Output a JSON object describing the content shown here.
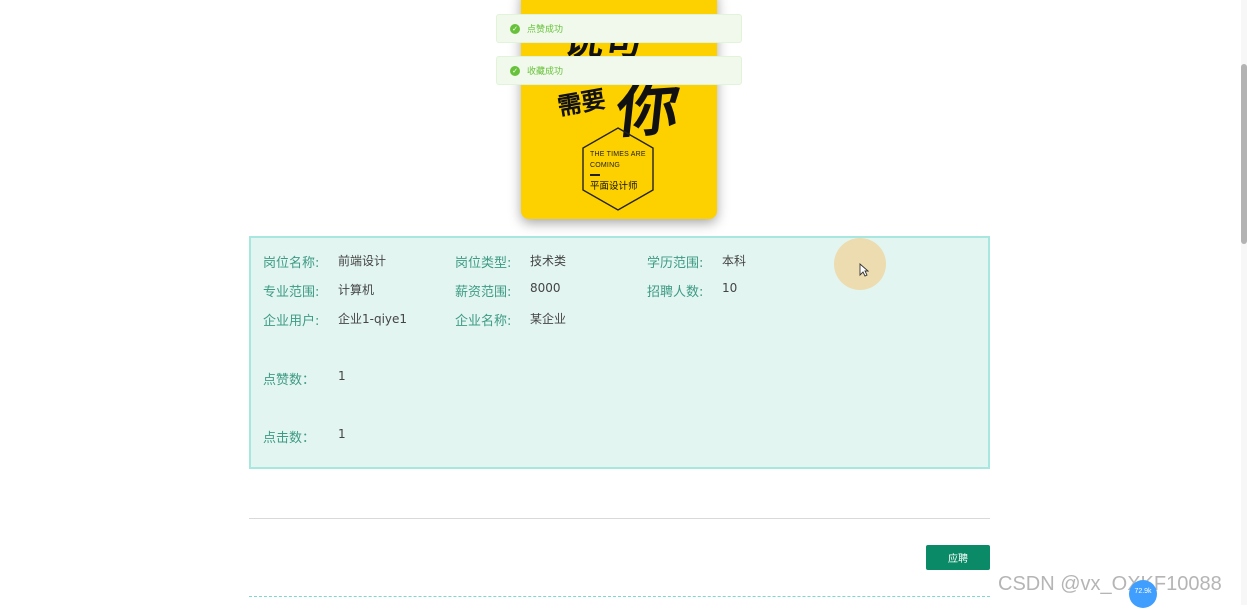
{
  "toasts": [
    {
      "text": "点赞成功"
    },
    {
      "text": "收藏成功"
    }
  ],
  "poster": {
    "brush_top": "说句",
    "brush_xu": "需要",
    "brush_ni": "你",
    "eng_line_1": "THE TIMES ARE",
    "eng_line_2": "COMING",
    "role": "平面设计师"
  },
  "details": {
    "job_name": {
      "label": "岗位名称:",
      "value": "前端设计"
    },
    "job_type": {
      "label": "岗位类型:",
      "value": "技术类"
    },
    "education": {
      "label": "学历范围:",
      "value": "本科"
    },
    "major": {
      "label": "专业范围:",
      "value": "计算机"
    },
    "salary": {
      "label": "薪资范围:",
      "value": "8000"
    },
    "headcount": {
      "label": "招聘人数:",
      "value": "10"
    },
    "company_user": {
      "label": "企业用户:",
      "value": "企业1-qiye1"
    },
    "company_name": {
      "label": "企业名称:",
      "value": "某企业"
    },
    "likes": {
      "label": "点赞数：",
      "value": "1"
    },
    "clicks": {
      "label": "点击数：",
      "value": "1"
    }
  },
  "actions": {
    "apply_label": "应聘"
  },
  "watermark": {
    "text": "CSDN @vx_OXKF10088"
  },
  "float_bubble": {
    "text": "72.9k"
  },
  "colors": {
    "accent": "#0a8a66",
    "panel_bg": "#e2f5f1",
    "panel_border": "#a8e6e0",
    "label": "#3e9a84",
    "toast_bg": "#f0f9eb",
    "toast_text": "#67c23a",
    "poster_bg": "#fdd000"
  }
}
